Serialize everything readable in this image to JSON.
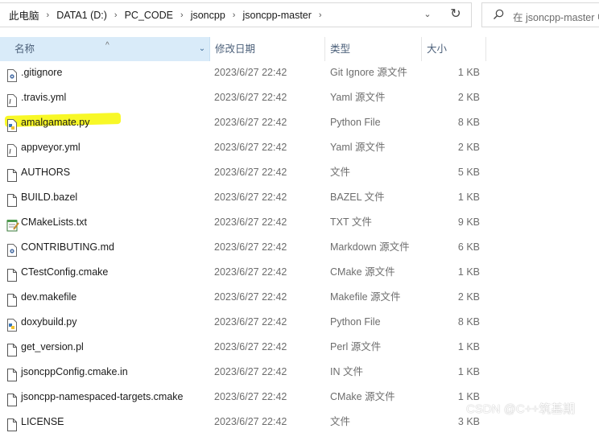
{
  "address_bar": {
    "crumbs": [
      "此电脑",
      "DATA1 (D:)",
      "PC_CODE",
      "jsoncpp",
      "jsoncpp-master"
    ],
    "separator": "›"
  },
  "search": {
    "placeholder": "在 jsoncpp-master 中搜索"
  },
  "columns": {
    "name": "名称",
    "date": "修改日期",
    "type": "类型",
    "size": "大小"
  },
  "files": [
    {
      "name": ".gitignore",
      "date": "2023/6/27 22:42",
      "type": "Git Ignore 源文件",
      "size": "1 KB",
      "icon": "gear-doc-icon"
    },
    {
      "name": ".travis.yml",
      "date": "2023/6/27 22:42",
      "type": "Yaml 源文件",
      "size": "2 KB",
      "icon": "text-doc-icon"
    },
    {
      "name": "amalgamate.py",
      "date": "2023/6/27 22:42",
      "type": "Python File",
      "size": "8 KB",
      "icon": "python-file-icon"
    },
    {
      "name": "appveyor.yml",
      "date": "2023/6/27 22:42",
      "type": "Yaml 源文件",
      "size": "2 KB",
      "icon": "text-doc-icon"
    },
    {
      "name": "AUTHORS",
      "date": "2023/6/27 22:42",
      "type": "文件",
      "size": "5 KB",
      "icon": "blank-file-icon"
    },
    {
      "name": "BUILD.bazel",
      "date": "2023/6/27 22:42",
      "type": "BAZEL 文件",
      "size": "1 KB",
      "icon": "blank-file-icon"
    },
    {
      "name": "CMakeLists.txt",
      "date": "2023/6/27 22:42",
      "type": "TXT 文件",
      "size": "9 KB",
      "icon": "notepad-icon"
    },
    {
      "name": "CONTRIBUTING.md",
      "date": "2023/6/27 22:42",
      "type": "Markdown 源文件",
      "size": "6 KB",
      "icon": "gear-doc-icon"
    },
    {
      "name": "CTestConfig.cmake",
      "date": "2023/6/27 22:42",
      "type": "CMake 源文件",
      "size": "1 KB",
      "icon": "blank-file-icon"
    },
    {
      "name": "dev.makefile",
      "date": "2023/6/27 22:42",
      "type": "Makefile 源文件",
      "size": "2 KB",
      "icon": "blank-file-icon"
    },
    {
      "name": "doxybuild.py",
      "date": "2023/6/27 22:42",
      "type": "Python File",
      "size": "8 KB",
      "icon": "python-file-icon"
    },
    {
      "name": "get_version.pl",
      "date": "2023/6/27 22:42",
      "type": "Perl 源文件",
      "size": "1 KB",
      "icon": "blank-file-icon"
    },
    {
      "name": "jsoncppConfig.cmake.in",
      "date": "2023/6/27 22:42",
      "type": "IN 文件",
      "size": "1 KB",
      "icon": "blank-file-icon"
    },
    {
      "name": "jsoncpp-namespaced-targets.cmake",
      "date": "2023/6/27 22:42",
      "type": "CMake 源文件",
      "size": "1 KB",
      "icon": "blank-file-icon"
    },
    {
      "name": "LICENSE",
      "date": "2023/6/27 22:42",
      "type": "文件",
      "size": "3 KB",
      "icon": "blank-file-icon"
    }
  ],
  "watermark": "CSDN @C++筑基期",
  "colors": {
    "header_selected": "#d9ebf9",
    "highlight": "#f7f715",
    "secondary_text": "#6d6d6d"
  }
}
